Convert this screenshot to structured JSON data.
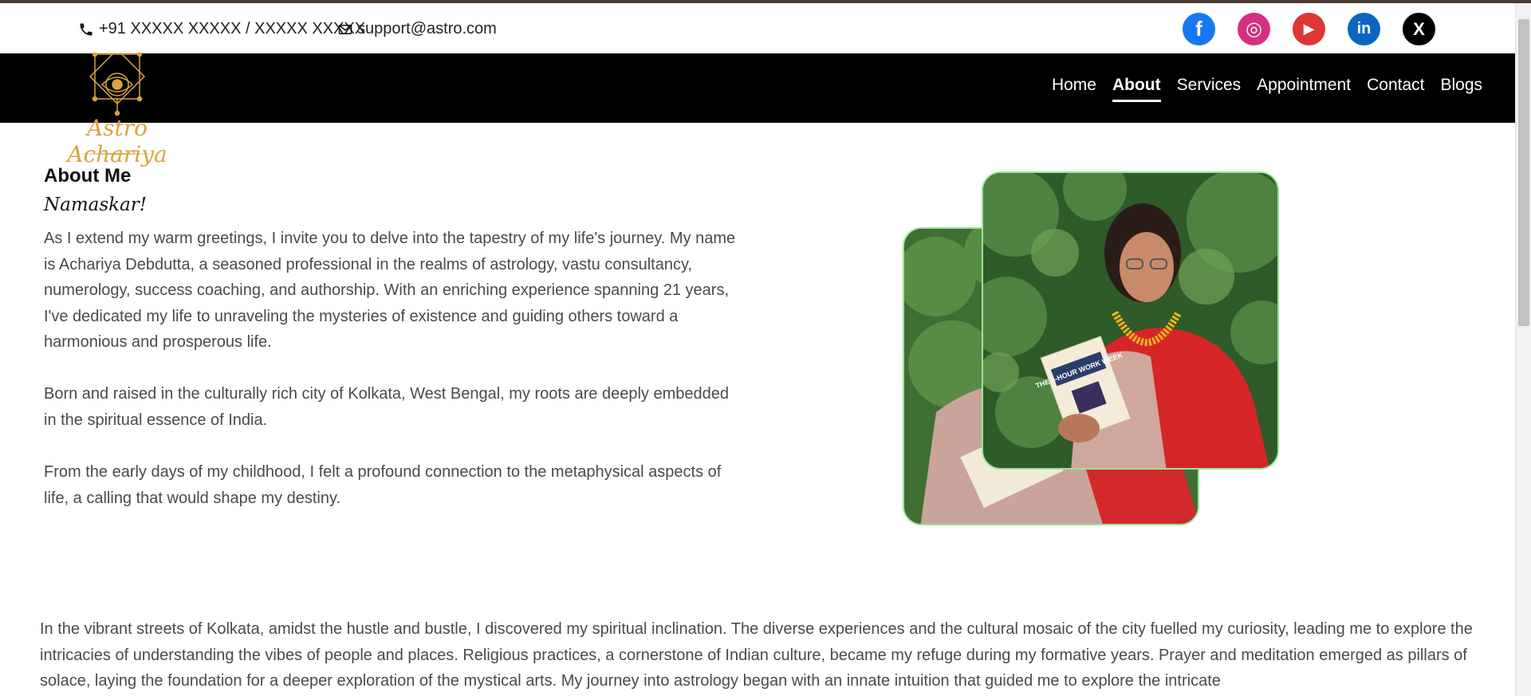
{
  "topbar": {
    "phone": "+91 XXXXX XXXXX / XXXXX XXXXX",
    "email": "support@astro.com",
    "socials": [
      {
        "name": "facebook",
        "glyph": "f",
        "color": "#1877f2"
      },
      {
        "name": "instagram",
        "glyph": "◎",
        "color": "#d62f7f"
      },
      {
        "name": "youtube",
        "glyph": "▶",
        "color": "#e03535"
      },
      {
        "name": "linkedin",
        "glyph": "in",
        "color": "#0a66c2"
      },
      {
        "name": "x",
        "glyph": "X",
        "color": "#000000"
      }
    ]
  },
  "logo": {
    "text": "Astro Achariya",
    "accent": "#d9a441"
  },
  "nav": {
    "items": [
      {
        "label": "Home"
      },
      {
        "label": "About"
      },
      {
        "label": "Services"
      },
      {
        "label": "Appointment"
      },
      {
        "label": "Contact"
      },
      {
        "label": "Blogs"
      }
    ],
    "active": "About"
  },
  "about": {
    "title": "About Me",
    "greeting": "Namaskar!",
    "paragraphs": [
      "As I extend my warm greetings, I invite you to delve into the tapestry of my life's journey. My name is Achariya Debdutta, a seasoned professional in the realms of astrology, vastu consultancy, numerology, success coaching, and authorship. With an enriching experience spanning 21 years, I've dedicated my life to unraveling the mysteries of existence and guiding others toward a harmonious and prosperous life.",
      "Born and raised in the culturally rich city of Kolkata, West Bengal, my roots are deeply embedded in the spiritual essence of India.",
      "From the early days of my childhood, I felt a profound connection to the metaphysical aspects of life, a calling that would shape my destiny.",
      "In the vibrant streets of Kolkata, amidst the hustle and bustle, I discovered my spiritual inclination. The diverse experiences and the cultural mosaic of the city fuelled my curiosity, leading me to explore the intricacies of understanding the vibes of people and places. Religious practices, a cornerstone of Indian culture, became my refuge during my formative years. Prayer and meditation emerged as pillars of solace, laying the foundation for a deeper exploration of the mystical arts. My journey into astrology began with an innate intuition that guided me to explore the intricate"
    ]
  },
  "photo": {
    "book_title": "THE 4-HOUR WORK WEEK"
  }
}
